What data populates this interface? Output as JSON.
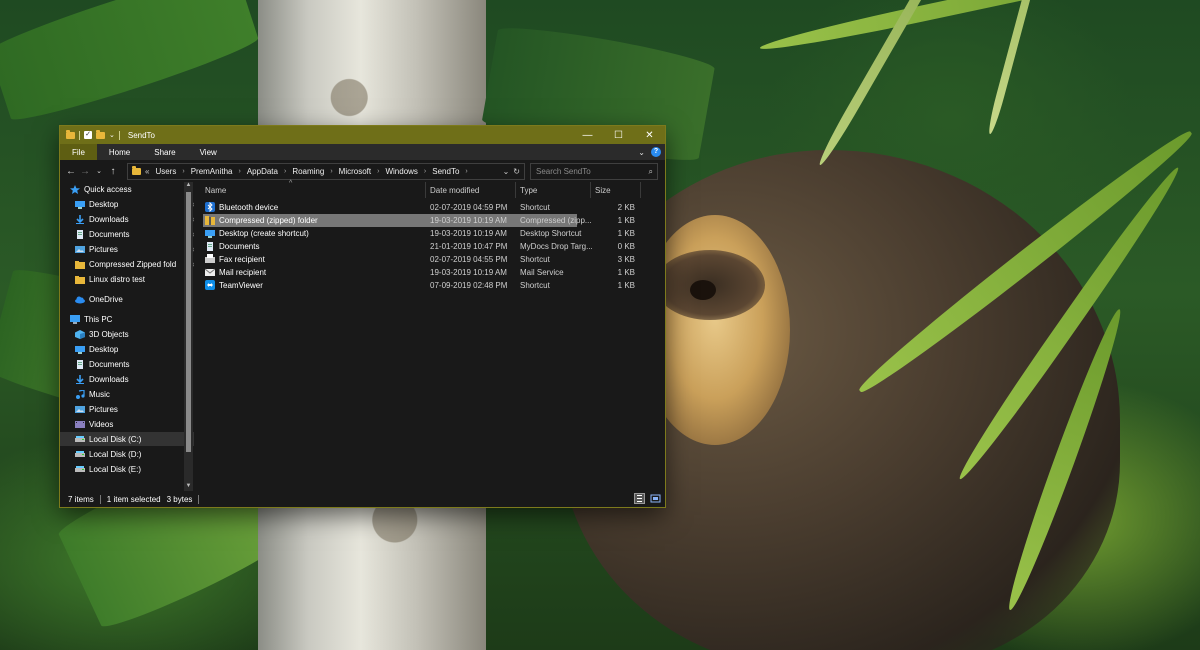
{
  "window": {
    "title": "SendTo",
    "controls": {
      "minimize": "—",
      "maximize": "☐",
      "close": "✕"
    }
  },
  "ribbon": {
    "tabs": [
      "File",
      "Home",
      "Share",
      "View"
    ]
  },
  "nav_buttons": {
    "back": "←",
    "forward": "→",
    "recent": "⌄",
    "up": "↑"
  },
  "address": {
    "breadcrumbs": [
      "Users",
      "PremAnitha",
      "AppData",
      "Roaming",
      "Microsoft",
      "Windows",
      "SendTo"
    ],
    "overflow": "«"
  },
  "search": {
    "placeholder": "Search SendTo"
  },
  "nav_pane": {
    "items": [
      {
        "label": "Quick access",
        "icon": "star-icon",
        "pinned": false
      },
      {
        "label": "Desktop",
        "icon": "desktop-icon",
        "pinned": true
      },
      {
        "label": "Downloads",
        "icon": "download-icon",
        "pinned": true
      },
      {
        "label": "Documents",
        "icon": "documents-icon",
        "pinned": true
      },
      {
        "label": "Pictures",
        "icon": "pictures-icon",
        "pinned": true
      },
      {
        "label": "Compressed Zipped fold",
        "icon": "folder-icon",
        "pinned": true
      },
      {
        "label": "Linux distro test",
        "icon": "folder-icon",
        "pinned": false
      },
      {
        "label": "OneDrive",
        "icon": "cloud-icon",
        "pinned": false
      },
      {
        "label": "This PC",
        "icon": "computer-icon",
        "pinned": false
      },
      {
        "label": "3D Objects",
        "icon": "cube-icon",
        "pinned": false
      },
      {
        "label": "Desktop",
        "icon": "desktop-icon",
        "pinned": false
      },
      {
        "label": "Documents",
        "icon": "documents-icon",
        "pinned": false
      },
      {
        "label": "Downloads",
        "icon": "download-icon",
        "pinned": false
      },
      {
        "label": "Music",
        "icon": "music-icon",
        "pinned": false
      },
      {
        "label": "Pictures",
        "icon": "pictures-icon",
        "pinned": false
      },
      {
        "label": "Videos",
        "icon": "video-icon",
        "pinned": false
      },
      {
        "label": "Local Disk (C:)",
        "icon": "drive-icon",
        "pinned": false
      },
      {
        "label": "Local Disk (D:)",
        "icon": "drive-icon",
        "pinned": false
      },
      {
        "label": "Local Disk (E:)",
        "icon": "drive-icon",
        "pinned": false
      }
    ]
  },
  "columns": [
    "Name",
    "Date modified",
    "Type",
    "Size"
  ],
  "files": [
    {
      "name": "Bluetooth device",
      "date": "02-07-2019 04:59 PM",
      "type": "Shortcut",
      "size": "2 KB",
      "icon": "bluetooth-icon",
      "selected": false
    },
    {
      "name": "Compressed (zipped) folder",
      "date": "19-03-2019 10:19 AM",
      "type": "Compressed (zipp...",
      "size": "1 KB",
      "icon": "zip-folder-icon",
      "selected": true
    },
    {
      "name": "Desktop (create shortcut)",
      "date": "19-03-2019 10:19 AM",
      "type": "Desktop Shortcut",
      "size": "1 KB",
      "icon": "desktop-icon",
      "selected": false
    },
    {
      "name": "Documents",
      "date": "21-01-2019 10:47 PM",
      "type": "MyDocs Drop Targ...",
      "size": "0 KB",
      "icon": "documents-icon",
      "selected": false
    },
    {
      "name": "Fax recipient",
      "date": "02-07-2019 04:55 PM",
      "type": "Shortcut",
      "size": "3 KB",
      "icon": "fax-icon",
      "selected": false
    },
    {
      "name": "Mail recipient",
      "date": "19-03-2019 10:19 AM",
      "type": "Mail Service",
      "size": "1 KB",
      "icon": "mail-icon",
      "selected": false
    },
    {
      "name": "TeamViewer",
      "date": "07-09-2019 02:48 PM",
      "type": "Shortcut",
      "size": "1 KB",
      "icon": "teamviewer-icon",
      "selected": false
    }
  ],
  "status": {
    "items_count": "7 items",
    "selection": "1 item selected",
    "selection_size": "3 bytes"
  },
  "colors": {
    "title_bar": "#6f6f18",
    "file_tab": "#5e5e12",
    "window_bg": "#191919",
    "selected_row": "#777777"
  }
}
